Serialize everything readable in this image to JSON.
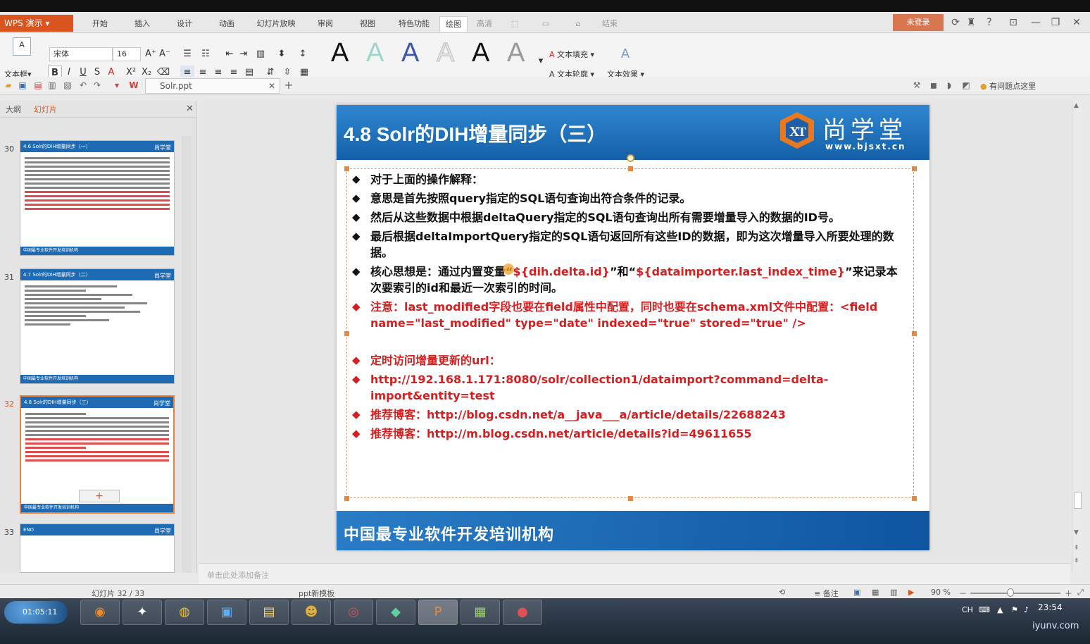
{
  "app": {
    "logo": "WPS 演示",
    "menu_tabs": [
      "开始",
      "插入",
      "设计",
      "动画",
      "幻灯片放映",
      "审阅",
      "视图",
      "特色功能",
      "绘图",
      "高清",
      "结束"
    ],
    "login": "未登录"
  },
  "ribbon": {
    "textbox_label": "文本框",
    "font_name": "宋体",
    "font_size": "16",
    "fill_label": "文本填充",
    "outline_label": "文本轮廓",
    "effect_label": "文本效果"
  },
  "tab": {
    "filename": "Solr.ppt"
  },
  "help_tip": "有问题点这里",
  "panel": {
    "tab_outline": "大纲",
    "tab_slides": "幻灯片",
    "thumbs": [
      {
        "num": "30",
        "title": "4.6 Solr的DIH增量同步（一）"
      },
      {
        "num": "31",
        "title": "4.7 Solr的DIH增量同步（二）"
      },
      {
        "num": "32",
        "title": "4.8 Solr的DIH增量同步（三）"
      },
      {
        "num": "33",
        "title": "END"
      }
    ],
    "brand_small": "尚学堂",
    "footer_small": "中国最专业软件开发培训机构",
    "add_slide": "+"
  },
  "slide": {
    "title": "4.8 Solr的DIH增量同步（三）",
    "brand_name": "尚学堂",
    "brand_url": "www.bjsxt.cn",
    "bullets": {
      "b1": "对于上面的操作解释：",
      "b2": "意思是首先按照query指定的SQL语句查询出符合条件的记录。",
      "b3": "然后从这些数据中根据deltaQuery指定的SQL语句查询出所有需要增量导入的数据的ID号。",
      "b4": "最后根据deltaImportQuery指定的SQL语句返回所有这些ID的数据，即为这次增量导入所要处理的数据。",
      "b5_pre": "核心思想是：通过内置变量“",
      "b5_var1": "${dih.delta.id}",
      "b5_mid": "”和“",
      "b5_var2": "${dataimporter.last_index_time}",
      "b5_post": "”来记录本次要索引的id和最近一次索引的时间。",
      "b6": "注意：last_modified字段也要在field属性中配置，同时也要在schema.xml文件中配置：<field name=\"last_modified\" type=\"date\" indexed=\"true\" stored=\"true\" />",
      "b7": "定时访问增量更新的url：",
      "b8": "http://192.168.1.171:8080/solr/collection1/dataimport?command=delta-import&entity=test",
      "b9": "推荐博客：http://blog.csdn.net/a__java___a/article/details/22688243",
      "b10": "推荐博客：http://m.blog.csdn.net/article/details?id=49611655"
    },
    "footer": "中国最专业软件开发培训机构"
  },
  "notes_placeholder": "单击此处添加备注",
  "status": {
    "slide_count": "幻灯片 32 / 33",
    "template": "ppt新模板",
    "notes_btn": "备注",
    "zoom": "90 %"
  },
  "taskbar": {
    "recorder_time": "01:05:11",
    "clock": "23:54",
    "ime": "CH",
    "watermark": "iyunv.com"
  },
  "colors": {
    "accent": "#d9541f",
    "slide_blue": "#1f6bb3",
    "highlight_red": "#d42020"
  }
}
